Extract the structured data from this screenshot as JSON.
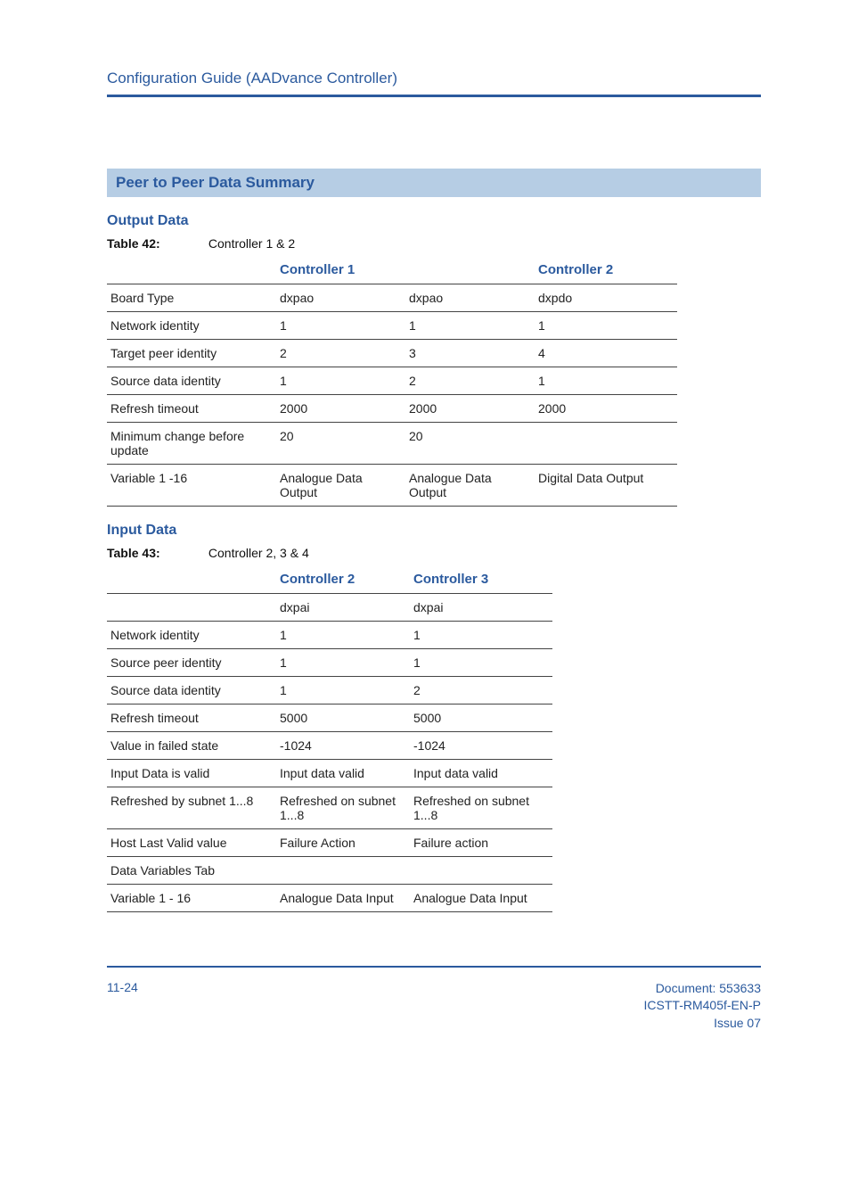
{
  "header": {
    "title": "Configuration Guide (AADvance Controller)"
  },
  "section": {
    "title": "Peer to Peer Data Summary"
  },
  "sub1": {
    "heading": "Output Data"
  },
  "t42": {
    "caption_label": "Table 42:",
    "caption_title": "Controller 1 & 2",
    "head": {
      "c1": "Controller 1",
      "c2": "Controller 2"
    },
    "rows": [
      {
        "a": "Board Type",
        "b": "dxpao",
        "c": "dxpao",
        "d": "dxpdo"
      },
      {
        "a": "Network identity",
        "b": "1",
        "c": "1",
        "d": "1"
      },
      {
        "a": "Target peer identity",
        "b": "2",
        "c": "3",
        "d": "4"
      },
      {
        "a": "Source data identity",
        "b": "1",
        "c": "2",
        "d": "1"
      },
      {
        "a": "Refresh timeout",
        "b": "2000",
        "c": "2000",
        "d": "2000"
      },
      {
        "a": "Minimum change before update",
        "b": "20",
        "c": "20",
        "d": ""
      },
      {
        "a": "Variable 1 -16",
        "b": "Analogue Data Output",
        "c": "Analogue Data Output",
        "d": "Digital Data Output"
      }
    ]
  },
  "sub2": {
    "heading": "Input Data"
  },
  "t43": {
    "caption_label": "Table 43:",
    "caption_title": "Controller 2, 3 & 4",
    "head": {
      "c1": "Controller 2",
      "c2": "Controller 3"
    },
    "rows": [
      {
        "a": "",
        "b": "dxpai",
        "c": "dxpai"
      },
      {
        "a": "Network identity",
        "b": "1",
        "c": "1"
      },
      {
        "a": "Source peer identity",
        "b": "1",
        "c": "1"
      },
      {
        "a": "Source data identity",
        "b": "1",
        "c": "2"
      },
      {
        "a": "Refresh timeout",
        "b": "5000",
        "c": "5000"
      },
      {
        "a": "Value in failed state",
        "b": "-1024",
        "c": "-1024"
      },
      {
        "a": "Input Data is valid",
        "b": "Input data valid",
        "c": "Input data valid"
      },
      {
        "a": "Refreshed by subnet 1...8",
        "b": "Refreshed on subnet 1...8",
        "c": "Refreshed on subnet 1...8"
      },
      {
        "a": "Host Last Valid value",
        "b": "Failure Action",
        "c": "Failure action"
      },
      {
        "a": "Data Variables Tab",
        "b": "",
        "c": ""
      },
      {
        "a": "Variable 1 - 16",
        "b": "Analogue Data Input",
        "c": "Analogue Data Input"
      }
    ]
  },
  "footer": {
    "page": "11-24",
    "doc_line": "Document: 553633",
    "ref_line": "ICSTT-RM405f-EN-P",
    "issue_line": "Issue 07"
  }
}
